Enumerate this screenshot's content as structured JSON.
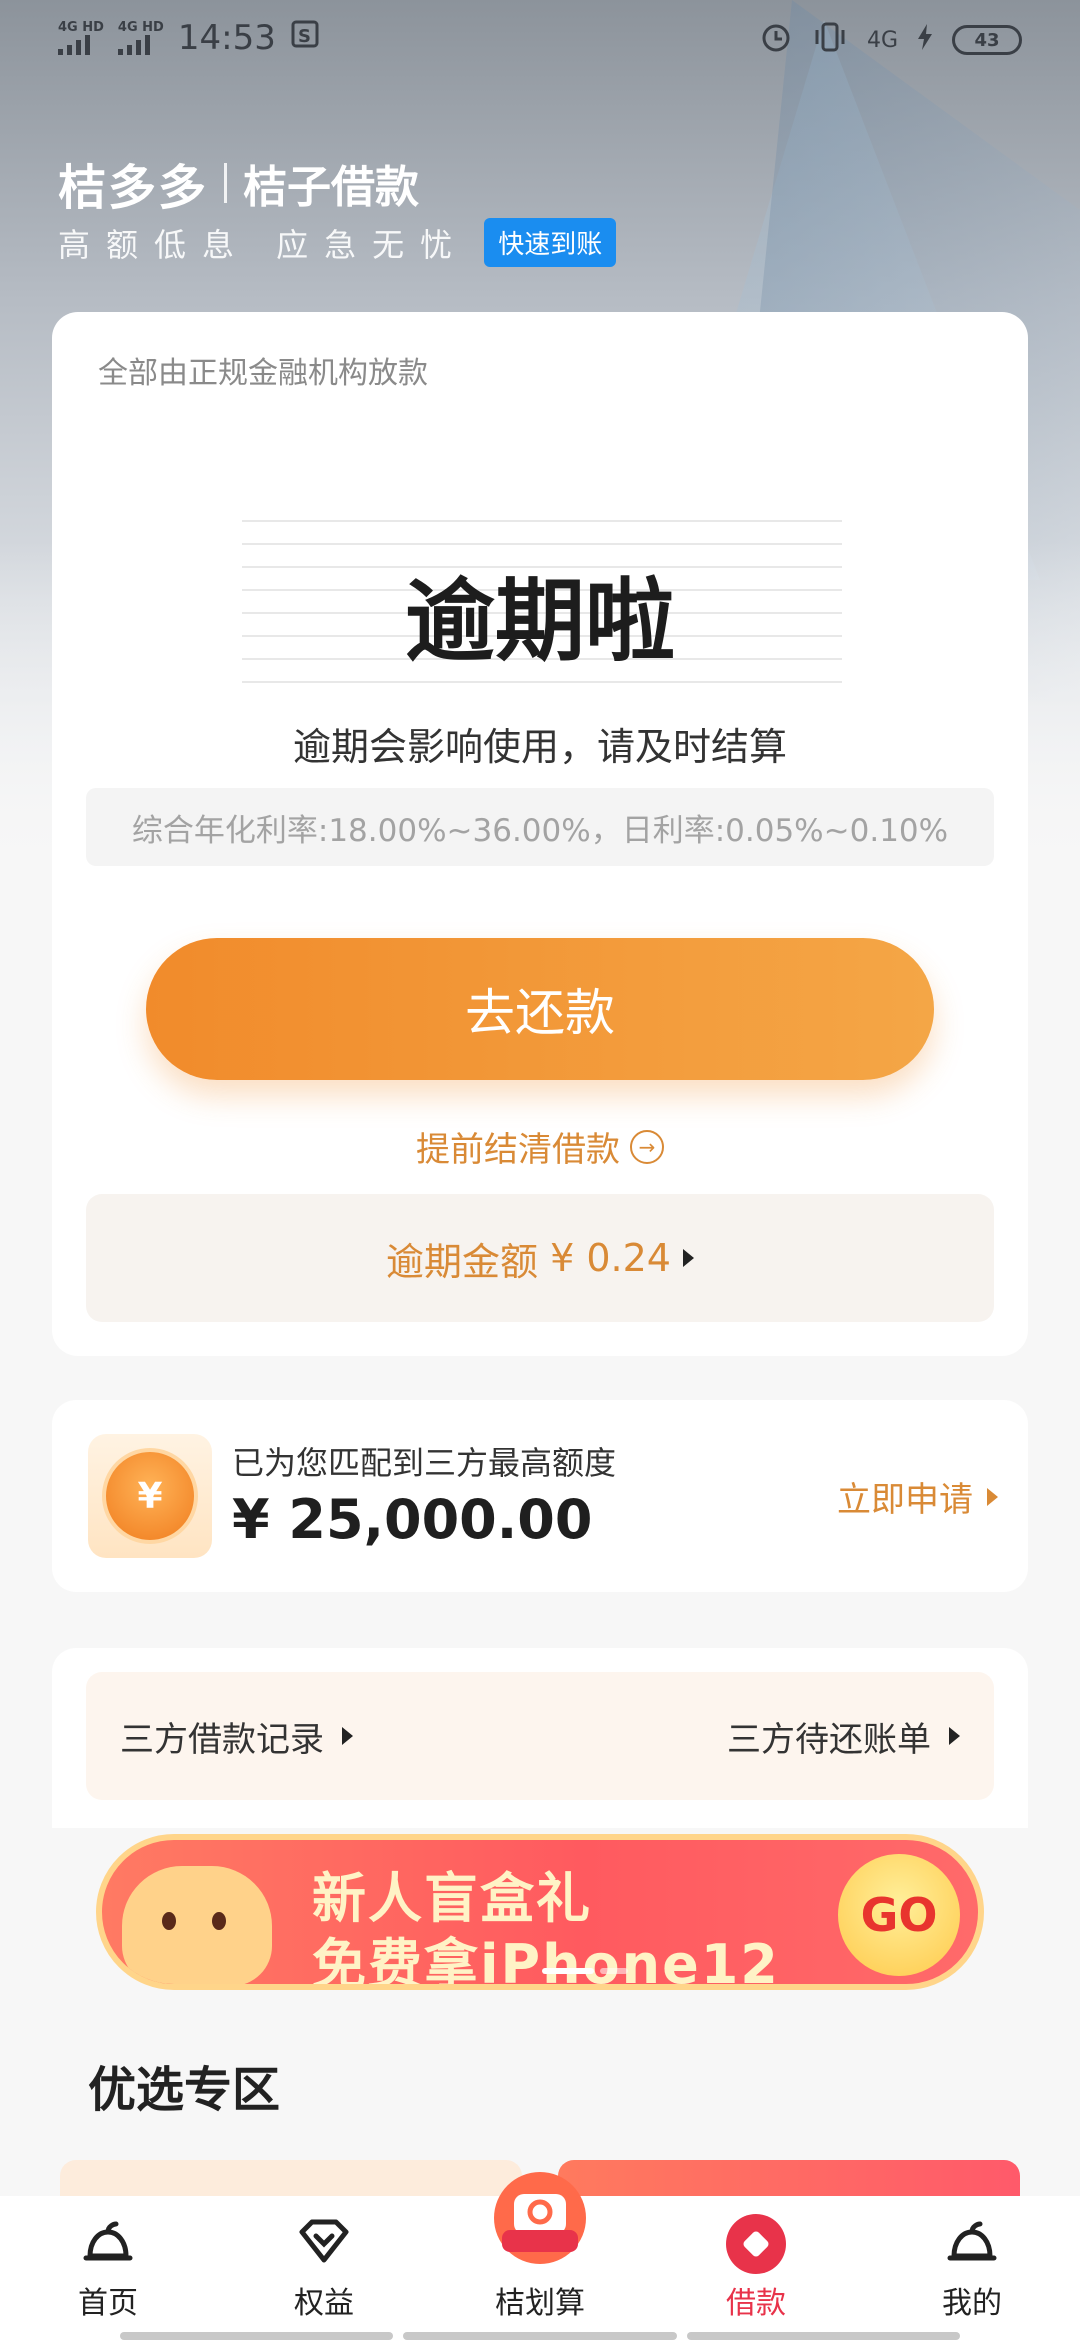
{
  "status_bar": {
    "network1": "4G HD",
    "network2": "4G HD",
    "time": "14:53",
    "network_right": "4G",
    "battery": "43"
  },
  "brand": {
    "logo": "桔多多",
    "name": "桔子借款",
    "slogan": "高额低息  应急无忧",
    "tag": "快速到账"
  },
  "main_card": {
    "note": "全部由正规金融机构放款",
    "title": "逾期啦",
    "subtitle": "逾期会影响使用，请及时结算",
    "rate_text": "综合年化利率:18.00%~36.00%，日利率:0.05%~0.10%",
    "repay_button": "去还款",
    "early_settle": "提前结清借款",
    "overdue_label": "逾期金额",
    "overdue_amount": "¥ 0.24"
  },
  "credit_card": {
    "label": "已为您匹配到三方最高额度",
    "amount": "¥ 25,000.00",
    "coin_symbol": "¥",
    "apply": "立即申请"
  },
  "records": {
    "left": "三方借款记录",
    "right": "三方待还账单"
  },
  "banner": {
    "line1": "新人盲盒礼",
    "line2": "免费拿iPhone12",
    "go": "GO"
  },
  "section": {
    "title": "优选专区"
  },
  "bottom_nav": [
    {
      "label": "首页",
      "icon": "home-bell-icon"
    },
    {
      "label": "权益",
      "icon": "heart-badge-icon"
    },
    {
      "label": "桔划算",
      "icon": "jhs-badge-icon",
      "badge": "桔划算"
    },
    {
      "label": "借款",
      "icon": "loan-icon",
      "active": true
    },
    {
      "label": "我的",
      "icon": "profile-bell-icon"
    }
  ],
  "colors": {
    "accent_orange": "#f18b2b",
    "accent_red": "#e8334a",
    "tag_blue": "#1a8df0"
  }
}
